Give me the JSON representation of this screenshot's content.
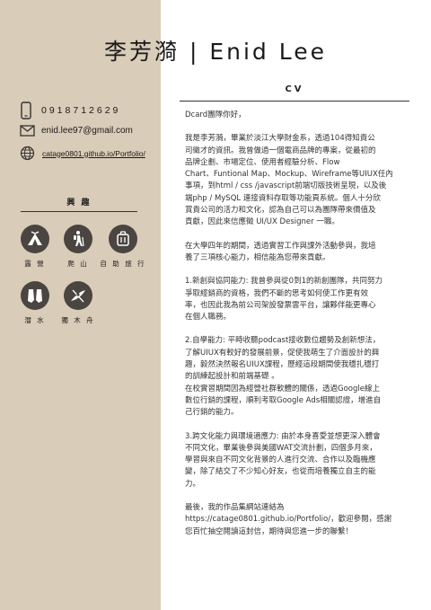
{
  "name": "李芳漪 | Enid Lee",
  "contact": {
    "phone": "0918712629",
    "email": "enid.lee97@gmail.com",
    "website": "catage0801.github.io/Portfolio/"
  },
  "hobbies": {
    "title": "興 趣",
    "items": [
      {
        "label": "露 營",
        "icon": "camping-tent-icon"
      },
      {
        "label": "爬 山",
        "icon": "hiking-icon"
      },
      {
        "label": "自 助 旅 行",
        "icon": "luggage-icon"
      },
      {
        "label": "潛 水",
        "icon": "diving-fins-icon"
      },
      {
        "label": "獨 木 舟",
        "icon": "kayak-icon"
      }
    ]
  },
  "cv": {
    "title": "CV",
    "paragraphs": [
      "Dcard團隊你好，",
      "我是李芳漪，畢業於淡江大學財金系，透過104得知貴公\n司徵才的資訊。我曾做過一個電商品牌的專案，從最初的\n品牌企劃、市場定位、使用者經驗分析、Flow\nChart、Funtional Map、Mockup、Wireframe等UIUX任內\n事項，到html / css /javascript前端切版技術呈現，以及後\n端php / MySQL 連接資料存取等功能頁系統。個人十分欣\n賞貴公司的活力和文化，認為自己可以為團隊帶來價值及\n貢獻，因此來信應徵 UI/UX Designer  一職。",
      "在大學四年的期間，透過實習工作與課外活動參與，我培\n養了三項核心能力，相信能為您帶來貢獻。",
      "1.新創與協同能力: 我曾參與從0到1的新創團隊，共同努力\n爭取經銷商的資格，我們不斷的思考如何使工作更有效\n率，也因此我為前公司架設發票雲平台，讓夥伴能更專心\n在個人職務。",
      "2.自學能力: 平時收聽podcast接收數位趨勢及創新想法，\n了解UIUX有較好的發展前景，促使我萌生了介面設計的興\n趣，毅然決然報名UIUX課程，歷經這段期間使我穩扎穩打\n的訓練起設計和前端基礎 。\n在校實習期間因為經營社群軟體的關係，透過Google線上\n數位行銷的課程，順利考取Google Ads相關認證，增進自\n己行銷的能力。",
      "3.跨文化能力與環境適應力: 由於本身喜愛並想更深入體會\n不同文化，畢業後參與美國WAT交流計劃，四個多月來，\n學習與來自不同文化背景的人進行交流、合作以及臨機應\n變，除了結交了不少知心好友，也從而培養獨立自主的能\n力。",
      "最後，我的作品集網站連結為\nhttps://catage0801.github.io/Portfolio/，歡迎參閱，感謝\n您百忙抽空閱讀這封信，期待與您進一步的聯繫！"
    ]
  }
}
